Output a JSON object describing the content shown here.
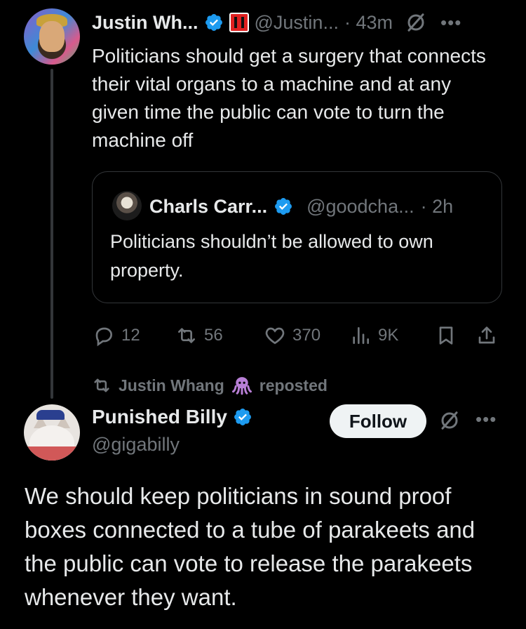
{
  "tweet1": {
    "author_name": "Justin Wh...",
    "author_handle": "@Justin...",
    "time": "· 43m",
    "text": "Politicians should get a surgery that connects their vital organs to a machine and at any given time the public can vote to turn the machine off",
    "quote": {
      "author_name": "Charls Carr...",
      "author_handle": "@goodcha...",
      "time": "· 2h",
      "text": "Politicians shouldn’t be allowed to own property."
    },
    "stats": {
      "replies": "12",
      "reposts": "56",
      "likes": "370",
      "views": "9K"
    }
  },
  "repost_banner": {
    "name": "Justin Whang",
    "suffix": "reposted"
  },
  "tweet2": {
    "author_name": "Punished Billy",
    "author_handle": "@gigabilly",
    "follow_label": "Follow",
    "text": "We should keep politicians in sound proof boxes connected to a tube of parakeets and the public can vote to release the parakeets whenever they want."
  },
  "icons": {
    "more": "•••",
    "verified": "verified-badge-icon",
    "grok": "grok-icon",
    "affiliate": "affiliate-badge-icon"
  },
  "colors": {
    "background": "#000000",
    "text": "#e7e9ea",
    "muted": "#71767b",
    "verified": "#1d9bf0",
    "border": "#333639",
    "affiliate_red": "#e02020",
    "repost_emoji": "#b87fd6"
  }
}
